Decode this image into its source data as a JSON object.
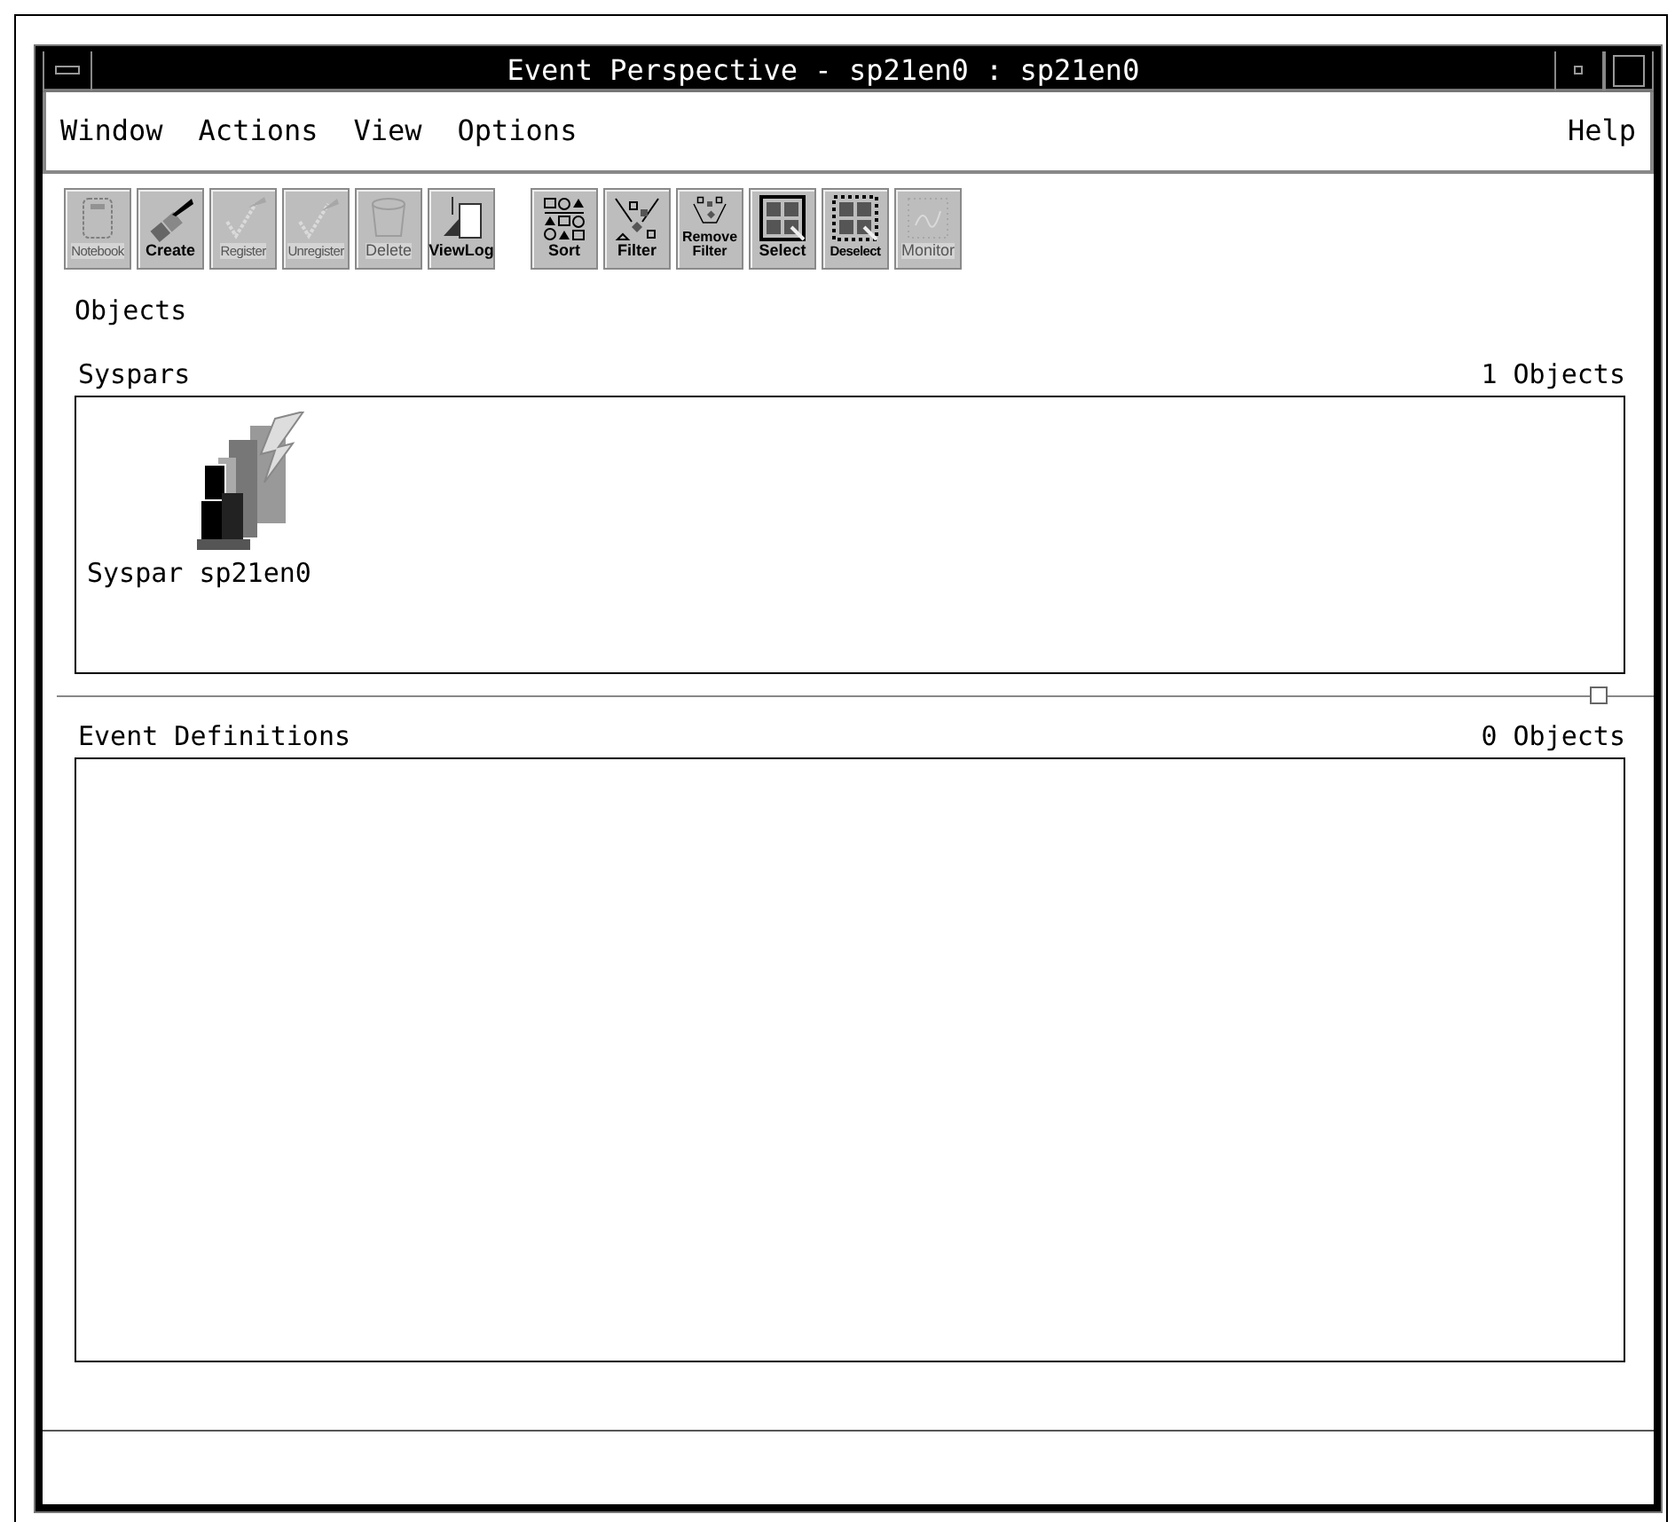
{
  "window": {
    "title": "Event Perspective - sp21en0 : sp21en0"
  },
  "menu": [
    {
      "label": "Window"
    },
    {
      "label": "Actions"
    },
    {
      "label": "View"
    },
    {
      "label": "Options"
    },
    {
      "label": "Help"
    }
  ],
  "toolbar": [
    {
      "kind": "notebook",
      "label": "Notebook",
      "disabled": true
    },
    {
      "kind": "create",
      "label": "Create",
      "disabled": false
    },
    {
      "kind": "register",
      "label": "Register",
      "disabled": true
    },
    {
      "kind": "unregister",
      "label": "Unregister",
      "disabled": true
    },
    {
      "kind": "delete",
      "label": "Delete",
      "disabled": true
    },
    {
      "kind": "viewlog",
      "label": "ViewLog",
      "disabled": false
    },
    {
      "kind": "sort",
      "label": "Sort",
      "disabled": false
    },
    {
      "kind": "filter",
      "label": "Filter",
      "disabled": false
    },
    {
      "kind": "removefilter",
      "label": "Remove Filter",
      "disabled": false
    },
    {
      "kind": "select",
      "label": "Select",
      "disabled": false
    },
    {
      "kind": "deselect",
      "label": "Deselect",
      "disabled": false
    },
    {
      "kind": "monitor",
      "label": "Monitor",
      "disabled": true
    }
  ],
  "objects_label": "Objects",
  "panes": [
    {
      "title": "Syspars",
      "count": "1 Objects",
      "items": [
        {
          "label": "Syspar sp21en0"
        }
      ]
    },
    {
      "title": "Event Definitions",
      "count": "0 Objects"
    }
  ]
}
